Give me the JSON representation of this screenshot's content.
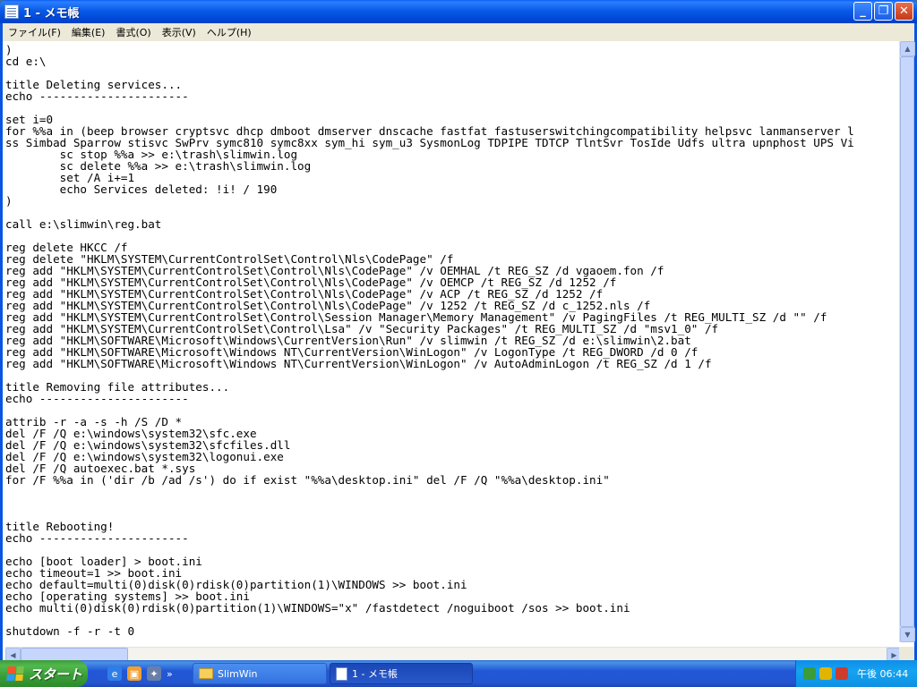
{
  "window": {
    "title": "1 - メモ帳",
    "minimize_glyph": "_",
    "maximize_glyph": "❐",
    "close_glyph": "✕"
  },
  "menu": {
    "items": [
      "ファイル(F)",
      "編集(E)",
      "書式(O)",
      "表示(V)",
      "ヘルプ(H)"
    ]
  },
  "document": {
    "lines": [
      ")",
      "cd e:\\",
      "",
      "title Deleting services...",
      "echo ----------------------",
      "",
      "set i=0",
      "for %%a in (beep browser cryptsvc dhcp dmboot dmserver dnscache fastfat fastuserswitchingcompatibility helpsvc lanmanserver l",
      "ss Simbad Sparrow stisvc SwPrv symc810 symc8xx sym_hi sym_u3 SysmonLog TDPIPE TDTCP TlntSvr TosIde Udfs ultra upnphost UPS Vi",
      "        sc stop %%a >> e:\\trash\\slimwin.log",
      "        sc delete %%a >> e:\\trash\\slimwin.log",
      "        set /A i+=1",
      "        echo Services deleted: !i! / 190",
      ")",
      "",
      "call e:\\slimwin\\reg.bat",
      "",
      "reg delete HKCC /f",
      "reg delete \"HKLM\\SYSTEM\\CurrentControlSet\\Control\\Nls\\CodePage\" /f",
      "reg add \"HKLM\\SYSTEM\\CurrentControlSet\\Control\\Nls\\CodePage\" /v OEMHAL /t REG_SZ /d vgaoem.fon /f",
      "reg add \"HKLM\\SYSTEM\\CurrentControlSet\\Control\\Nls\\CodePage\" /v OEMCP /t REG_SZ /d 1252 /f",
      "reg add \"HKLM\\SYSTEM\\CurrentControlSet\\Control\\Nls\\CodePage\" /v ACP /t REG_SZ /d 1252 /f",
      "reg add \"HKLM\\SYSTEM\\CurrentControlSet\\Control\\Nls\\CodePage\" /v 1252 /t REG_SZ /d c_1252.nls /f",
      "reg add \"HKLM\\SYSTEM\\CurrentControlSet\\Control\\Session Manager\\Memory Management\" /v PagingFiles /t REG_MULTI_SZ /d \"\" /f",
      "reg add \"HKLM\\SYSTEM\\CurrentControlSet\\Control\\Lsa\" /v \"Security Packages\" /t REG_MULTI_SZ /d \"msv1_0\" /f",
      "reg add \"HKLM\\SOFTWARE\\Microsoft\\Windows\\CurrentVersion\\Run\" /v slimwin /t REG_SZ /d e:\\slimwin\\2.bat",
      "reg add \"HKLM\\SOFTWARE\\Microsoft\\Windows NT\\CurrentVersion\\WinLogon\" /v LogonType /t REG_DWORD /d 0 /f",
      "reg add \"HKLM\\SOFTWARE\\Microsoft\\Windows NT\\CurrentVersion\\WinLogon\" /v AutoAdminLogon /t REG_SZ /d 1 /f",
      "",
      "title Removing file attributes...",
      "echo ----------------------",
      "",
      "attrib -r -a -s -h /S /D *",
      "del /F /Q e:\\windows\\system32\\sfc.exe",
      "del /F /Q e:\\windows\\system32\\sfcfiles.dll",
      "del /F /Q e:\\windows\\system32\\logonui.exe",
      "del /F /Q autoexec.bat *.sys",
      "for /F %%a in ('dir /b /ad /s') do if exist \"%%a\\desktop.ini\" del /F /Q \"%%a\\desktop.ini\"",
      "",
      "",
      "",
      "title Rebooting!",
      "echo ----------------------",
      "",
      "echo [boot loader] > boot.ini",
      "echo timeout=1 >> boot.ini",
      "echo default=multi(0)disk(0)rdisk(0)partition(1)\\WINDOWS >> boot.ini",
      "echo [operating systems] >> boot.ini",
      "echo multi(0)disk(0)rdisk(0)partition(1)\\WINDOWS=\"x\" /fastdetect /noguiboot /sos >> boot.ini",
      "",
      "shutdown -f -r -t 0"
    ]
  },
  "scrollbars": {
    "up_glyph": "▲",
    "down_glyph": "▼",
    "left_glyph": "◀",
    "right_glyph": "▶"
  },
  "taskbar": {
    "start_label": "スタート",
    "quicklaunch_more": "»",
    "tasks": [
      {
        "label": "SlimWin",
        "icon": "folder-icon",
        "active": false
      },
      {
        "label": "1 - メモ帳",
        "icon": "notepad-icon",
        "active": true
      }
    ],
    "clock": "午後 06:44"
  }
}
